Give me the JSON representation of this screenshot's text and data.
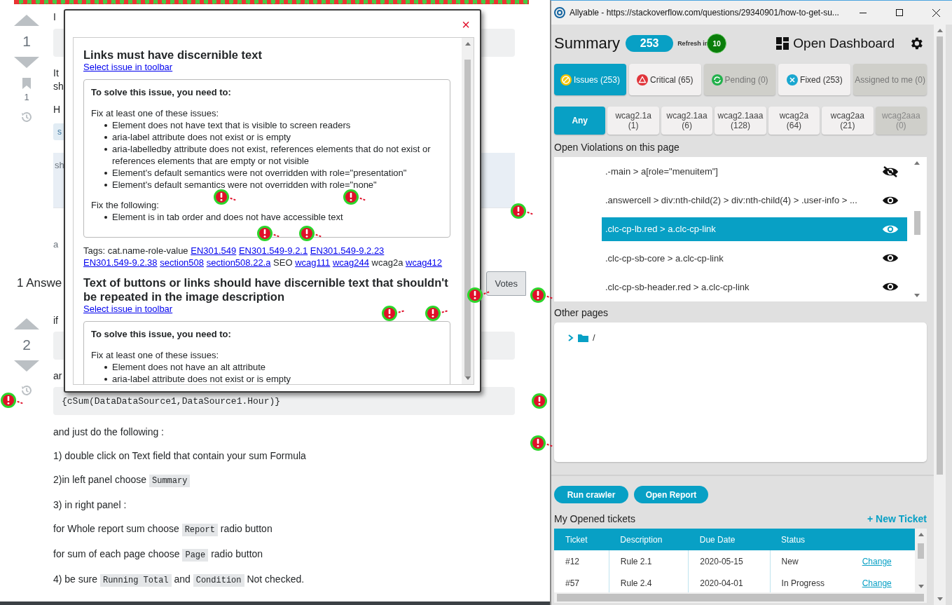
{
  "page": {
    "question": {
      "votes": "1",
      "bookmarks": "1",
      "first_line": "I",
      "paragraph_lines": [
        "It",
        "sh"
      ],
      "line_3": "H",
      "tag": "s",
      "notice": "sh",
      "meta": "a"
    },
    "answers_header": {
      "title": "1 Answe",
      "sort_button": "Votes"
    },
    "answer": {
      "votes": "2",
      "line_1": "if",
      "line_2": "ar",
      "code": "{cSum(DataDataSource1,DataSource1.Hour)}",
      "paragraphs": [
        [
          {
            "kind": "text",
            "text": "and just do the following :"
          }
        ],
        [
          {
            "kind": "text",
            "text": "1) double click on Text field that contain your sum Formula"
          }
        ],
        [
          {
            "kind": "text",
            "text": "2)in left panel choose "
          },
          {
            "kind": "code",
            "text": "Summary"
          }
        ],
        [
          {
            "kind": "text",
            "text": "3) in right panel :"
          }
        ],
        [
          {
            "kind": "text",
            "text": "for Whole report sum choose "
          },
          {
            "kind": "code",
            "text": "Report"
          },
          {
            "kind": "text",
            "text": " radio button"
          }
        ],
        [
          {
            "kind": "text",
            "text": "for sum of each page choose "
          },
          {
            "kind": "code",
            "text": "Page"
          },
          {
            "kind": "text",
            "text": " radio button"
          }
        ],
        [
          {
            "kind": "text",
            "text": "4) be sure "
          },
          {
            "kind": "code",
            "text": "Running Total"
          },
          {
            "kind": "text",
            "text": " and "
          },
          {
            "kind": "code",
            "text": "Condition"
          },
          {
            "kind": "text",
            "text": " Not checked."
          }
        ]
      ]
    }
  },
  "modal": {
    "close": "×",
    "issues": [
      {
        "title": "Links must have discernible text",
        "link": "Select issue in toolbar",
        "solve_heading": "To solve this issue, you need to:",
        "groups": [
          {
            "heading": "Fix at least one of these issues:",
            "items": [
              "Element does not have text that is visible to screen readers",
              "aria-label attribute does not exist or is empty",
              "aria-labelledby attribute does not exist, references elements that do not exist or references elements that are empty or not visible",
              "Element's default semantics were not overridden with role=\"presentation\"",
              "Element's default semantics were not overridden with role=\"none\""
            ]
          },
          {
            "heading": "Fix the following:",
            "items": [
              "Element is in tab order and does not have accessible text"
            ]
          }
        ],
        "tags_label": "Tags:",
        "tags": [
          {
            "kind": "plain",
            "text": "cat.name-role-value"
          },
          {
            "kind": "link",
            "text": "EN301.549"
          },
          {
            "kind": "link",
            "text": "EN301.549-9.2.1"
          },
          {
            "kind": "link",
            "text": "EN301.549-9.2.23"
          },
          {
            "kind": "link",
            "text": "EN301.549-9.2.38"
          },
          {
            "kind": "link",
            "text": "section508"
          },
          {
            "kind": "link",
            "text": "section508.22.a"
          },
          {
            "kind": "plain",
            "text": "SEO"
          },
          {
            "kind": "link",
            "text": "wcag111"
          },
          {
            "kind": "link",
            "text": "wcag244"
          },
          {
            "kind": "plain",
            "text": "wcag2a"
          },
          {
            "kind": "link",
            "text": "wcag412"
          }
        ]
      },
      {
        "title": "Text of buttons or links should have discernible text that shouldn't be repeated in the image description",
        "link": "Select issue in toolbar",
        "solve_heading": "To solve this issue, you need to:",
        "groups": [
          {
            "heading": "Fix at least one of these issues:",
            "items": [
              "Element does not have an alt attribute",
              "aria-label attribute does not exist or is empty"
            ]
          }
        ]
      }
    ]
  },
  "allyable": {
    "window_title": "Allyable - https://stackoverflow.com/questions/29340901/how-to-get-su...",
    "heading": "Summary",
    "count": "253",
    "refresh_label": "Refresh in",
    "refresh_timer": "10",
    "dashboard": "Open Dashboard",
    "filters": [
      {
        "kind": "issues",
        "label": "Issues (253)",
        "selected": true,
        "disabled": false
      },
      {
        "kind": "critical",
        "label": "Critical (65)",
        "selected": false,
        "disabled": false
      },
      {
        "kind": "pending",
        "label": "Pending (0)",
        "selected": false,
        "disabled": true
      },
      {
        "kind": "fixed",
        "label": "Fixed (253)",
        "selected": false,
        "disabled": false
      },
      {
        "kind": "assigned",
        "label": "Assigned to me (0)",
        "selected": false,
        "disabled": true
      }
    ],
    "levels": [
      {
        "label": "Any",
        "selected": true,
        "disabled": false
      },
      {
        "label": "wcag2.1a",
        "count": "(1)",
        "selected": false,
        "disabled": false
      },
      {
        "label": "wcag2.1aa",
        "count": "(6)",
        "selected": false,
        "disabled": false
      },
      {
        "label": "wcag2.1aaa",
        "count": "(128)",
        "selected": false,
        "disabled": false
      },
      {
        "label": "wcag2a",
        "count": "(64)",
        "selected": false,
        "disabled": false
      },
      {
        "label": "wcag2aa",
        "count": "(21)",
        "selected": false,
        "disabled": false
      },
      {
        "label": "wcag2aaa",
        "count": "(0)",
        "selected": false,
        "disabled": true
      }
    ],
    "violations_title": "Open Violations on this page",
    "violations": [
      {
        "selector": ".-main > a[role=\"menuitem\"]",
        "selected": false,
        "hidden": true
      },
      {
        "selector": ".answercell > div:nth-child(2) > div:nth-child(4) > .user-info > ...",
        "selected": false,
        "hidden": false
      },
      {
        "selector": ".clc-cp-lb.red > a.clc-cp-link",
        "selected": true,
        "hidden": false
      },
      {
        "selector": ".clc-cp-sb-core > a.clc-cp-link",
        "selected": false,
        "hidden": false
      },
      {
        "selector": ".clc-cp-sb-header.red > a.clc-cp-link",
        "selected": false,
        "hidden": false
      }
    ],
    "other_pages_title": "Other pages",
    "tree": [
      {
        "label": "/",
        "expanded": false
      }
    ],
    "buttons": [
      "Run crawler",
      "Open Report"
    ],
    "tickets_title": "My Opened tickets",
    "new_ticket": "+ New Ticket",
    "tickets": {
      "columns": [
        "Ticket",
        "Description",
        "Due Date",
        "Status"
      ],
      "rows": [
        {
          "cells": [
            "#12",
            "Rule 2.1",
            "2020-05-15",
            "New"
          ],
          "action": "Change"
        },
        {
          "cells": [
            "#57",
            "Rule 2.4",
            "2020-04-01",
            "In Progress"
          ],
          "action": "Change"
        }
      ]
    }
  }
}
